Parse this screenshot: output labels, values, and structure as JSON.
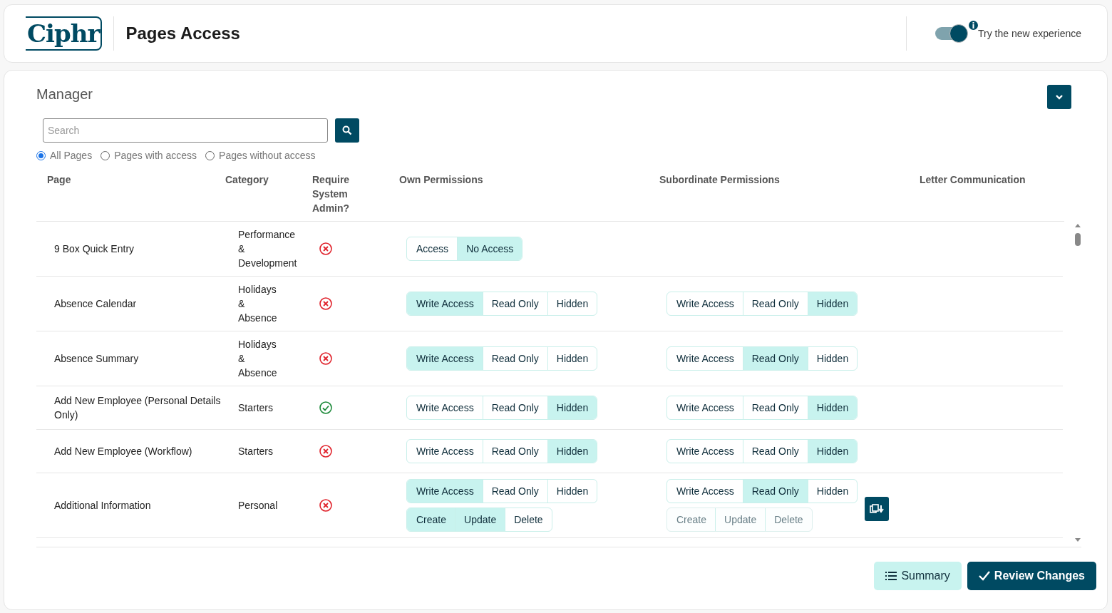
{
  "header": {
    "logo": "Ciphr",
    "title": "Pages Access",
    "toggle": {
      "on": true,
      "label": "Try the new experience"
    }
  },
  "section": {
    "title": "Manager",
    "expanded": false
  },
  "search": {
    "placeholder": "Search"
  },
  "filters": [
    {
      "label": "All Pages",
      "selected": true
    },
    {
      "label": "Pages with access",
      "selected": false
    },
    {
      "label": "Pages without access",
      "selected": false
    }
  ],
  "table": {
    "columns": [
      "Page",
      "Category",
      "Require System Admin?",
      "Own Permissions",
      "Subordinate Permissions",
      "Letter Communication"
    ],
    "rows": [
      {
        "page": "9 Box Quick Entry",
        "category": "Performance & Development",
        "require_admin": false,
        "own": [
          {
            "disabled": false,
            "options": [
              {
                "label": "Access",
                "selected": false
              },
              {
                "label": "No Access",
                "selected": true
              }
            ]
          }
        ],
        "subordinate": [],
        "copy_button": false
      },
      {
        "page": "Absence Calendar",
        "category": "Holidays & Absence",
        "require_admin": false,
        "own": [
          {
            "disabled": false,
            "options": [
              {
                "label": "Write Access",
                "selected": true
              },
              {
                "label": "Read Only",
                "selected": false
              },
              {
                "label": "Hidden",
                "selected": false
              }
            ]
          }
        ],
        "subordinate": [
          {
            "disabled": false,
            "options": [
              {
                "label": "Write Access",
                "selected": false
              },
              {
                "label": "Read Only",
                "selected": false
              },
              {
                "label": "Hidden",
                "selected": true
              }
            ]
          }
        ],
        "copy_button": false
      },
      {
        "page": "Absence Summary",
        "category": "Holidays & Absence",
        "require_admin": false,
        "own": [
          {
            "disabled": false,
            "options": [
              {
                "label": "Write Access",
                "selected": true
              },
              {
                "label": "Read Only",
                "selected": false
              },
              {
                "label": "Hidden",
                "selected": false
              }
            ]
          }
        ],
        "subordinate": [
          {
            "disabled": false,
            "options": [
              {
                "label": "Write Access",
                "selected": false
              },
              {
                "label": "Read Only",
                "selected": true
              },
              {
                "label": "Hidden",
                "selected": false
              }
            ]
          }
        ],
        "copy_button": false
      },
      {
        "page": "Add New Employee (Personal Details Only)",
        "category": "Starters",
        "require_admin": true,
        "own": [
          {
            "disabled": false,
            "options": [
              {
                "label": "Write Access",
                "selected": false
              },
              {
                "label": "Read Only",
                "selected": false
              },
              {
                "label": "Hidden",
                "selected": true
              }
            ]
          }
        ],
        "subordinate": [
          {
            "disabled": false,
            "options": [
              {
                "label": "Write Access",
                "selected": false
              },
              {
                "label": "Read Only",
                "selected": false
              },
              {
                "label": "Hidden",
                "selected": true
              }
            ]
          }
        ],
        "copy_button": false
      },
      {
        "page": "Add New Employee (Workflow)",
        "category": "Starters",
        "require_admin": false,
        "own": [
          {
            "disabled": false,
            "options": [
              {
                "label": "Write Access",
                "selected": false
              },
              {
                "label": "Read Only",
                "selected": false
              },
              {
                "label": "Hidden",
                "selected": true
              }
            ]
          }
        ],
        "subordinate": [
          {
            "disabled": false,
            "options": [
              {
                "label": "Write Access",
                "selected": false
              },
              {
                "label": "Read Only",
                "selected": false
              },
              {
                "label": "Hidden",
                "selected": true
              }
            ]
          }
        ],
        "copy_button": false
      },
      {
        "page": "Additional Information",
        "category": "Personal",
        "require_admin": false,
        "own": [
          {
            "disabled": false,
            "options": [
              {
                "label": "Write Access",
                "selected": true
              },
              {
                "label": "Read Only",
                "selected": false
              },
              {
                "label": "Hidden",
                "selected": false
              }
            ]
          },
          {
            "disabled": false,
            "options": [
              {
                "label": "Create",
                "selected": true
              },
              {
                "label": "Update",
                "selected": true
              },
              {
                "label": "Delete",
                "selected": false
              }
            ]
          }
        ],
        "subordinate": [
          {
            "disabled": false,
            "options": [
              {
                "label": "Write Access",
                "selected": false
              },
              {
                "label": "Read Only",
                "selected": true
              },
              {
                "label": "Hidden",
                "selected": false
              }
            ]
          },
          {
            "disabled": true,
            "options": [
              {
                "label": "Create",
                "selected": false
              },
              {
                "label": "Update",
                "selected": false
              },
              {
                "label": "Delete",
                "selected": false
              }
            ]
          }
        ],
        "copy_button": true
      }
    ]
  },
  "footer": {
    "buttons": [
      {
        "label": "Summary",
        "kind": "secondary"
      },
      {
        "label": "Review Changes",
        "kind": "primary"
      }
    ]
  }
}
